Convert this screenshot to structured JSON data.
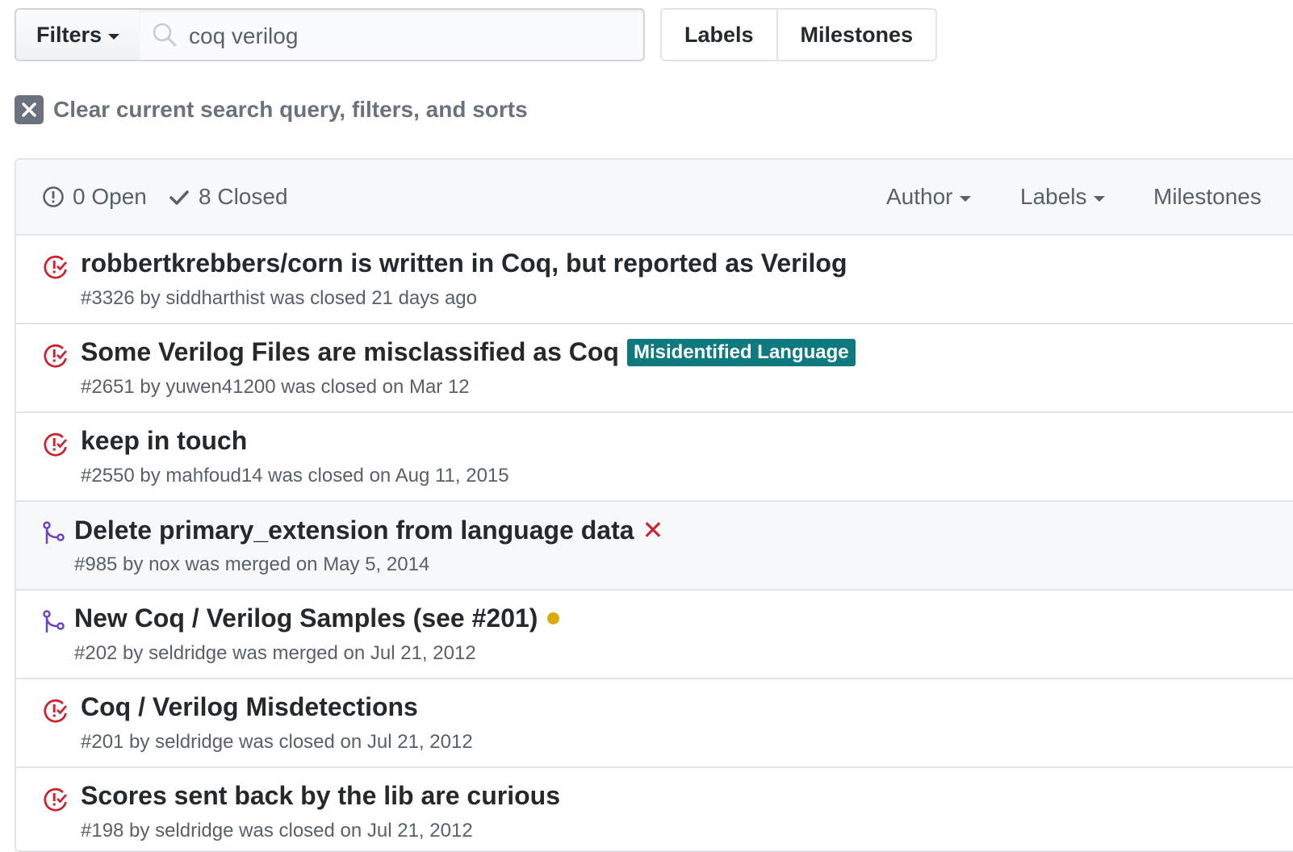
{
  "toolbar": {
    "filters_label": "Filters",
    "search_value": "coq verilog",
    "labels_label": "Labels",
    "milestones_label": "Milestones"
  },
  "clear": {
    "text": "Clear current search query, filters, and sorts"
  },
  "header": {
    "open": "0 Open",
    "closed": "8 Closed",
    "author": "Author",
    "labels": "Labels",
    "milestones": "Milestones"
  },
  "issues": [
    {
      "type": "issue-closed",
      "title": "robbertkrebbers/corn is written in Coq, but reported as Verilog",
      "meta": "#3326 by siddharthist was closed 21 days ago"
    },
    {
      "type": "issue-closed",
      "title": "Some Verilog Files are misclassified as Coq",
      "label": "Misidentified Language",
      "label_color": "#0e7a80",
      "meta": "#2651 by yuwen41200 was closed on Mar 12"
    },
    {
      "type": "issue-closed",
      "title": "keep in touch",
      "meta": "#2550 by mahfoud14 was closed on Aug 11, 2015"
    },
    {
      "type": "pr-merged",
      "title": "Delete primary_extension from language data",
      "status": "failure",
      "meta": "#985 by nox was merged on May 5, 2014"
    },
    {
      "type": "pr-merged",
      "title": "New Coq / Verilog Samples (see #201)",
      "status": "pending",
      "meta": "#202 by seldridge was merged on Jul 21, 2012"
    },
    {
      "type": "issue-closed",
      "title": "Coq / Verilog Misdetections",
      "meta": "#201 by seldridge was closed on Jul 21, 2012"
    },
    {
      "type": "issue-closed",
      "title": "Scores sent back by the lib are curious",
      "meta": "#198 by seldridge was closed on Jul 21, 2012"
    }
  ],
  "colors": {
    "closed_issue": "#cb2431",
    "merged_pr": "#6f42c1",
    "pending": "#dbab09",
    "failure": "#cb2431"
  }
}
